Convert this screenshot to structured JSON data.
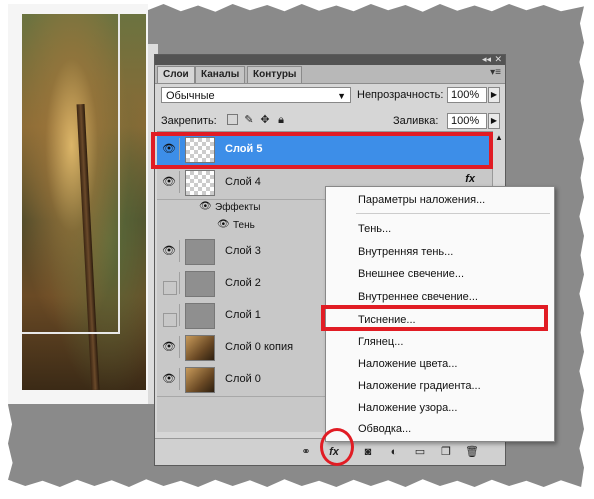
{
  "panel": {
    "tabs": [
      {
        "label": "Слои",
        "active": true
      },
      {
        "label": "Каналы",
        "active": false
      },
      {
        "label": "Контуры",
        "active": false
      }
    ],
    "blend_mode": "Обычные",
    "opacity_label": "Непрозрачность:",
    "opacity_value": "100%",
    "lock_label": "Закрепить:",
    "fill_label": "Заливка:",
    "fill_value": "100%"
  },
  "layers": [
    {
      "name": "Слой 5",
      "visible": true,
      "selected": true,
      "thumb": "transparent"
    },
    {
      "name": "Слой 4",
      "visible": true,
      "selected": false,
      "thumb": "transparent",
      "fx": "fx"
    },
    {
      "name": "Слой 3",
      "visible": true,
      "selected": false,
      "thumb": "gray"
    },
    {
      "name": "Слой 2",
      "visible": false,
      "selected": false,
      "thumb": "gray"
    },
    {
      "name": "Слой 1",
      "visible": false,
      "selected": false,
      "thumb": "gray"
    },
    {
      "name": "Слой 0 копия",
      "visible": true,
      "selected": false,
      "thumb": "photo"
    },
    {
      "name": "Слой 0",
      "visible": true,
      "selected": false,
      "thumb": "photo"
    }
  ],
  "effects": {
    "label": "Эффекты",
    "items": [
      "Тень"
    ]
  },
  "fx_menu": {
    "items": [
      "Параметры наложения...",
      "Тень...",
      "Внутренняя тень...",
      "Внешнее свечение...",
      "Внутреннее свечение...",
      "Тиснение...",
      "Глянец...",
      "Наложение цвета...",
      "Наложение градиента...",
      "Наложение узора...",
      "Обводка..."
    ],
    "highlighted": "Тиснение..."
  },
  "bottom_bar": {
    "icons": [
      "link-icon",
      "fx-icon",
      "mask-icon",
      "adjustment-icon",
      "group-icon",
      "new-layer-icon",
      "trash-icon"
    ],
    "fx_label": "fx"
  },
  "colors": {
    "selection_blue": "#3d8ee8",
    "highlight_red": "#e11c24",
    "panel_bg": "#d6d6d6",
    "canvas_gray": "#8a8a8a"
  }
}
